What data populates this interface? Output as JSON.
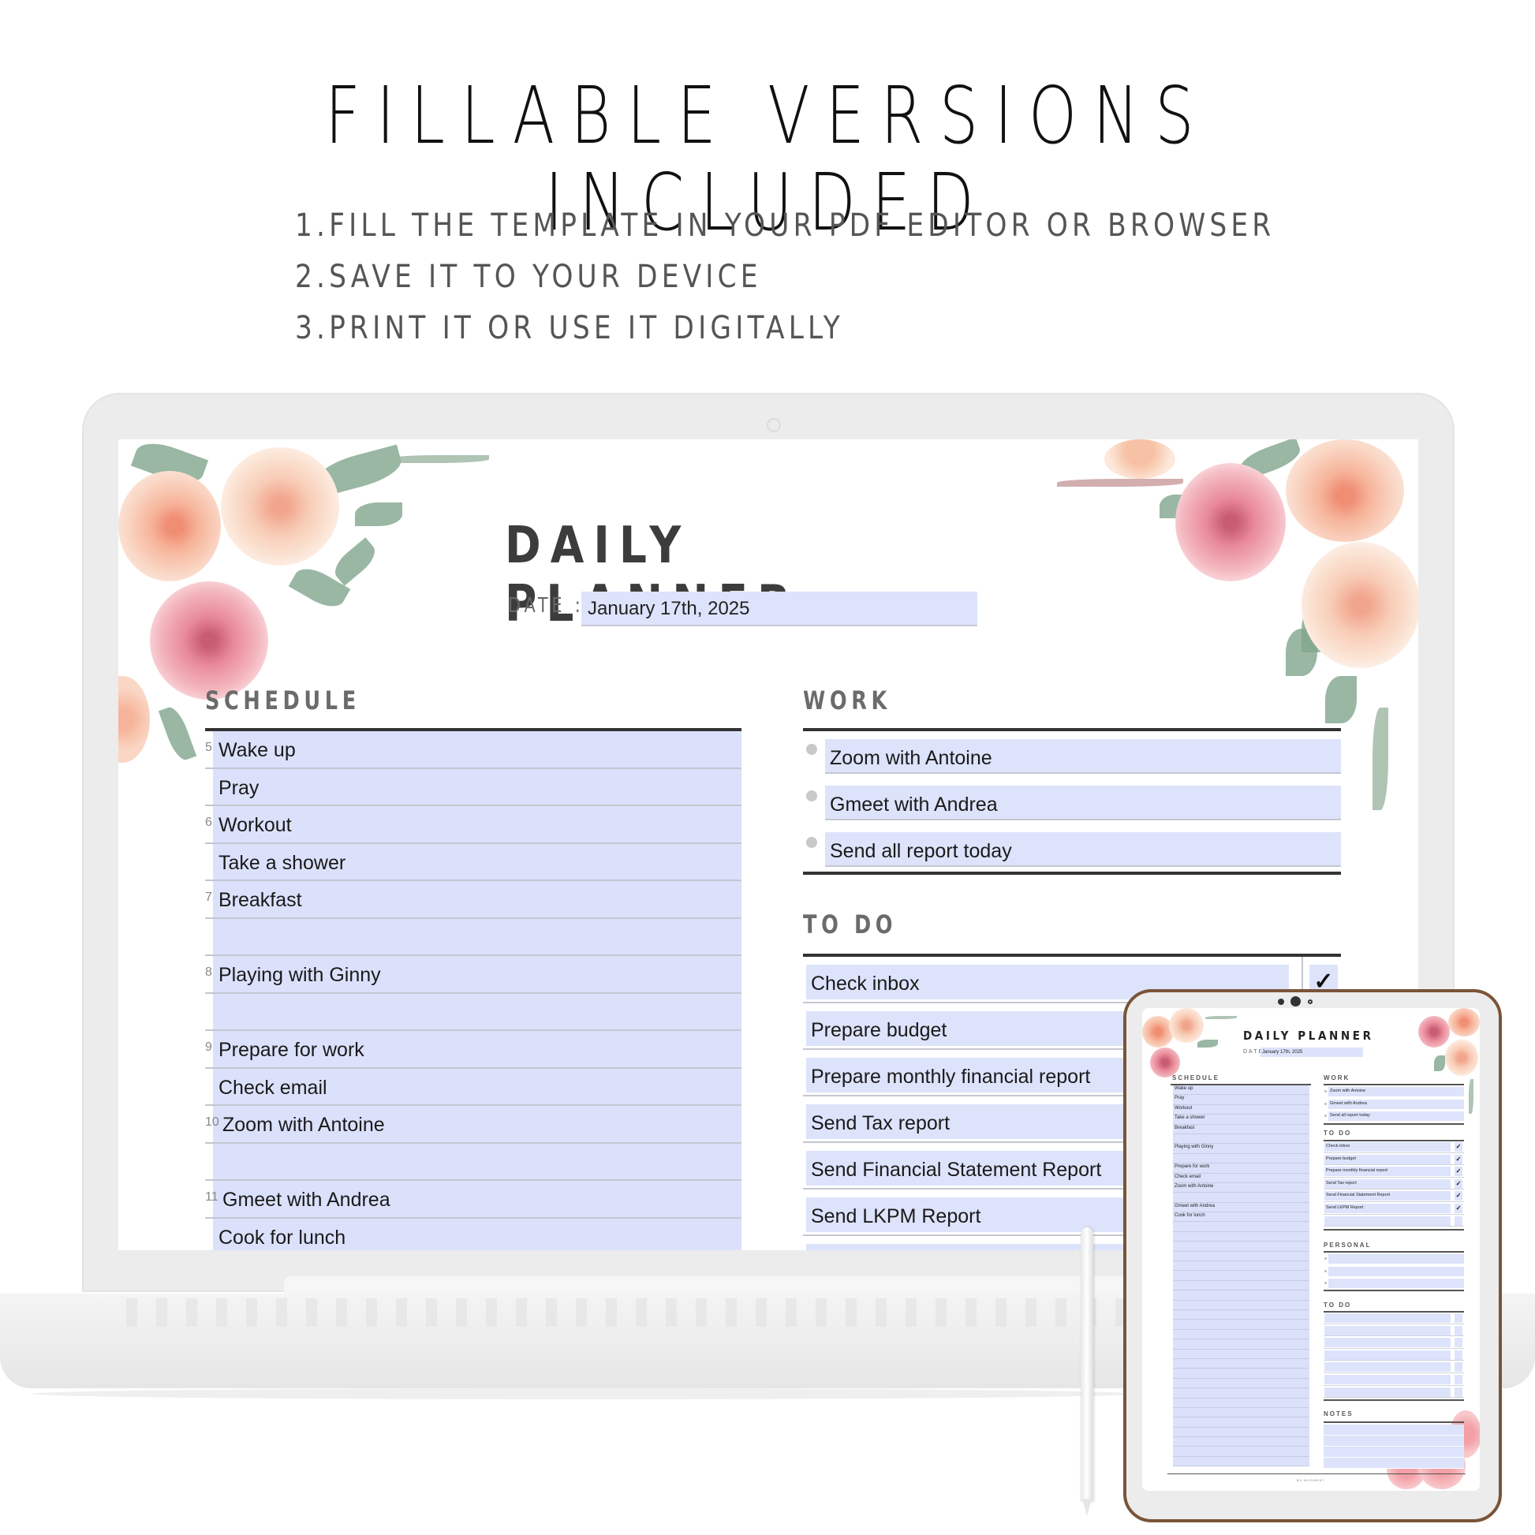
{
  "headline": "FILLABLE VERSIONS INCLUDED",
  "steps": [
    "1.FILL THE TEMPLATE IN YOUR PDF EDITOR OR BROWSER",
    "2.SAVE IT TO YOUR DEVICE",
    "3.PRINT IT OR USE IT DIGITALLY"
  ],
  "colors": {
    "field_fill": "#dde3fb",
    "heading_gray": "#6b6b6b",
    "rule_dark": "#333333",
    "tablet_frame": "#7a5438",
    "rose_pink": "#e98a9a",
    "rose_peach": "#f6c1a4",
    "leaf_green": "#7fa58c"
  },
  "planner": {
    "title": "DAILY PLANNER",
    "date_label": "DATE :",
    "date_value": "January 17th, 2025",
    "schedule": {
      "title": "SCHEDULE",
      "rows": [
        {
          "hour": "5",
          "text": "Wake up"
        },
        {
          "hour": "",
          "text": "Pray"
        },
        {
          "hour": "6",
          "text": "Workout"
        },
        {
          "hour": "",
          "text": "Take a shower"
        },
        {
          "hour": "7",
          "text": "Breakfast"
        },
        {
          "hour": "",
          "text": ""
        },
        {
          "hour": "8",
          "text": "Playing with Ginny"
        },
        {
          "hour": "",
          "text": ""
        },
        {
          "hour": "9",
          "text": "Prepare for work"
        },
        {
          "hour": "",
          "text": "Check email"
        },
        {
          "hour": "10",
          "text": "Zoom with Antoine"
        },
        {
          "hour": "",
          "text": ""
        },
        {
          "hour": "11",
          "text": "Gmeet with Andrea"
        },
        {
          "hour": "",
          "text": "Cook for lunch"
        }
      ]
    },
    "work": {
      "title": "WORK",
      "items": [
        "Zoom with Antoine",
        "Gmeet with Andrea",
        "Send all report today"
      ]
    },
    "todo": {
      "title": "TO DO",
      "items": [
        {
          "text": "Check inbox",
          "checked": "✓"
        },
        {
          "text": "Prepare budget",
          "checked": "✓"
        },
        {
          "text": "Prepare monthly financial report",
          "checked": "✓"
        },
        {
          "text": "Send Tax report",
          "checked": "✓"
        },
        {
          "text": "Send Financial Statement Report",
          "checked": "✓"
        },
        {
          "text": "Send LKPM Report",
          "checked": "✓"
        },
        {
          "text": "",
          "checked": ""
        }
      ]
    },
    "personal": {
      "title": "PERSONAL"
    },
    "todo2": {
      "title": "TO DO"
    },
    "notes": {
      "title": "NOTES"
    },
    "credit": "BY MYSNEAT"
  },
  "icons": {
    "checkmark": "✓",
    "bullet": "•"
  }
}
